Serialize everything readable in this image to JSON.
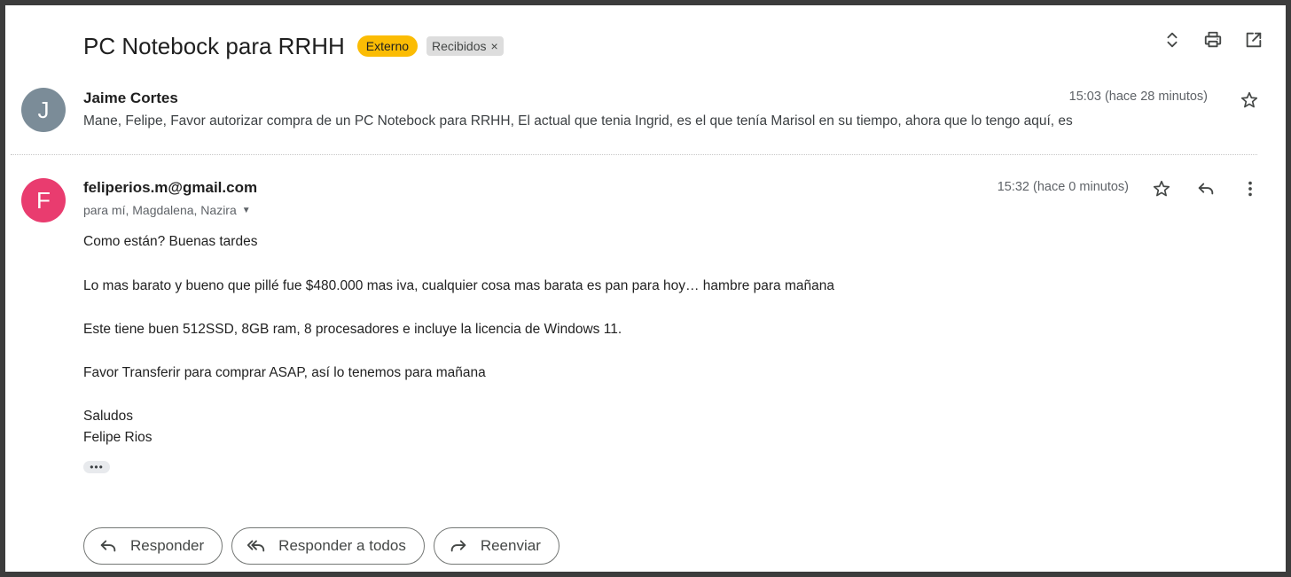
{
  "subject": "PC Notebock para RRHH",
  "labels": {
    "external": "Externo",
    "inbox": "Recibidos",
    "inbox_remove": "×"
  },
  "toolbar_icons": [
    "expand-collapse-icon",
    "print-icon",
    "open-new-window-icon"
  ],
  "messages": [
    {
      "avatar_letter": "J",
      "avatar_color": "#7b8c98",
      "sender": "Jaime Cortes",
      "time": "15:03 (hace 28 minutos)",
      "snippet": "Mane, Felipe, Favor autorizar compra de un PC Notebock para RRHH, El actual que tenia Ingrid, es el que tenía Marisol en su tiempo, ahora que lo tengo aquí, es"
    },
    {
      "avatar_letter": "F",
      "avatar_color": "#e93c6f",
      "sender": "feliperios.m@gmail.com",
      "recipients": "para mí, Magdalena, Nazira",
      "time": "15:32 (hace 0 minutos)",
      "body": [
        "Como están? Buenas tardes",
        "Lo mas barato y bueno que pillé fue $480.000 mas iva, cualquier cosa mas barata es pan para hoy… hambre para mañana",
        "Este tiene buen 512SSD, 8GB ram, 8 procesadores e incluye la licencia de Windows 11.",
        "Favor Transferir para comprar ASAP, así lo tenemos para mañana",
        "Saludos",
        "Felipe Rios"
      ],
      "trimmed_content": "•••"
    }
  ],
  "actions": {
    "reply": "Responder",
    "reply_all": "Responder a todos",
    "forward": "Reenviar"
  },
  "colors": {
    "external_label": "#fbbc04",
    "inbox_label": "#dddddd"
  }
}
